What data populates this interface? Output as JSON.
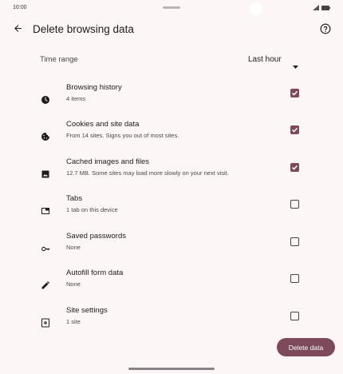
{
  "status_bar": {
    "time": "10:00"
  },
  "app_bar": {
    "title": "Delete browsing data"
  },
  "time_range": {
    "label": "Time range",
    "value": "Last hour"
  },
  "options": [
    {
      "title": "Browsing history",
      "subtitle": "4 items",
      "checked": true,
      "icon": "history-icon"
    },
    {
      "title": "Cookies and site data",
      "subtitle": "From 14 sites. Signs you out of most sites.",
      "checked": true,
      "icon": "cookie-icon"
    },
    {
      "title": "Cached images and files",
      "subtitle": "12.7 MB. Some sites may load more slowly on your next visit.",
      "checked": true,
      "icon": "image-icon"
    },
    {
      "title": "Tabs",
      "subtitle": "1 tab on this device",
      "checked": false,
      "icon": "tab-icon"
    },
    {
      "title": "Saved passwords",
      "subtitle": "None",
      "checked": false,
      "icon": "key-icon"
    },
    {
      "title": "Autofill form data",
      "subtitle": "None",
      "checked": false,
      "icon": "pencil-icon"
    },
    {
      "title": "Site settings",
      "subtitle": "1 site",
      "checked": false,
      "icon": "site-settings-icon"
    }
  ],
  "actions": {
    "delete_label": "Delete data"
  },
  "colors": {
    "accent": "#7c4a5a",
    "background": "#fdf6f6"
  }
}
